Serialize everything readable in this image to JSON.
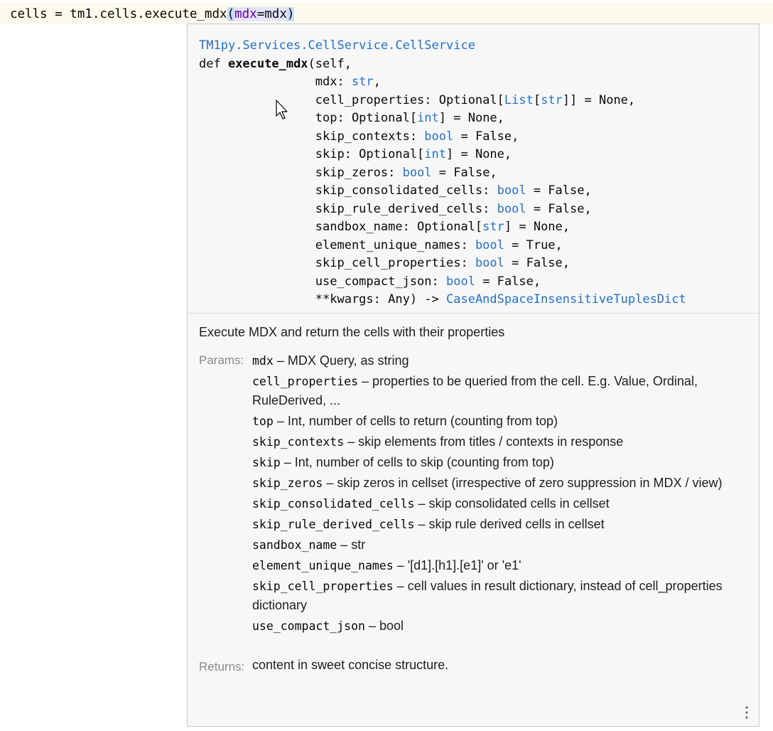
{
  "editor": {
    "code_prefix": "cells = tm1.cells.execute_mdx",
    "open_paren": "(",
    "kw_name": "mdx",
    "equals": "=",
    "arg_value": "mdx",
    "close_paren": ")"
  },
  "popup": {
    "qualified_name": "TM1py.Services.CellService.CellService",
    "def_keyword": "def ",
    "func_name": "execute_mdx",
    "first_param": "(self,",
    "signature_params": [
      {
        "name": "mdx: ",
        "type": "str",
        "rest": ","
      },
      {
        "name": "cell_properties: Optional[",
        "type": "List",
        "mid": "[",
        "type2": "str",
        "rest": "]] = None,"
      },
      {
        "name": "top: Optional[",
        "type": "int",
        "rest": "] = None,"
      },
      {
        "name": "skip_contexts: ",
        "type": "bool",
        "rest": " = False,"
      },
      {
        "name": "skip: Optional[",
        "type": "int",
        "rest": "] = None,"
      },
      {
        "name": "skip_zeros: ",
        "type": "bool",
        "rest": " = False,"
      },
      {
        "name": "skip_consolidated_cells: ",
        "type": "bool",
        "rest": " = False,"
      },
      {
        "name": "skip_rule_derived_cells: ",
        "type": "bool",
        "rest": " = False,"
      },
      {
        "name": "sandbox_name: Optional[",
        "type": "str",
        "rest": "] = None,"
      },
      {
        "name": "element_unique_names: ",
        "type": "bool",
        "rest": " = True,"
      },
      {
        "name": "skip_cell_properties: ",
        "type": "bool",
        "rest": " = False,"
      },
      {
        "name": "use_compact_json: ",
        "type": "bool",
        "rest": " = False,"
      },
      {
        "name": "**kwargs: Any) -> ",
        "type": "CaseAndSpaceInsensitiveTuplesDict",
        "rest": ""
      }
    ],
    "description": "Execute MDX and return the cells with their properties",
    "params_label": "Params:",
    "params": [
      {
        "name": "mdx",
        "text": " – MDX Query, as string"
      },
      {
        "name": "cell_properties",
        "text": " – properties to be queried from the cell. E.g. Value, Ordinal, RuleDerived, ..."
      },
      {
        "name": "top",
        "text": " – Int, number of cells to return (counting from top)"
      },
      {
        "name": "skip_contexts",
        "text": " – skip elements from titles / contexts in response"
      },
      {
        "name": "skip",
        "text": " – Int, number of cells to skip (counting from top)"
      },
      {
        "name": "skip_zeros",
        "text": " – skip zeros in cellset (irrespective of zero suppression in MDX / view)"
      },
      {
        "name": "skip_consolidated_cells",
        "text": " – skip consolidated cells in cellset"
      },
      {
        "name": "skip_rule_derived_cells",
        "text": " – skip rule derived cells in cellset"
      },
      {
        "name": "sandbox_name",
        "text": " – str"
      },
      {
        "name": "element_unique_names",
        "text": " – '[d1].[h1].[e1]' or 'e1'"
      },
      {
        "name": "skip_cell_properties",
        "text": " – cell values in result dictionary, instead of cell_properties dictionary"
      },
      {
        "name": "use_compact_json",
        "text": " – bool"
      }
    ],
    "returns_label": "Returns:",
    "returns": "content in sweet concise structure.",
    "more_icon": "vertical-ellipsis-icon"
  },
  "colors": {
    "type_blue": "#2470c4",
    "kw_purple": "#660099",
    "line_highlight": "#fcfaed",
    "popup_bg": "#f7f7f7"
  }
}
